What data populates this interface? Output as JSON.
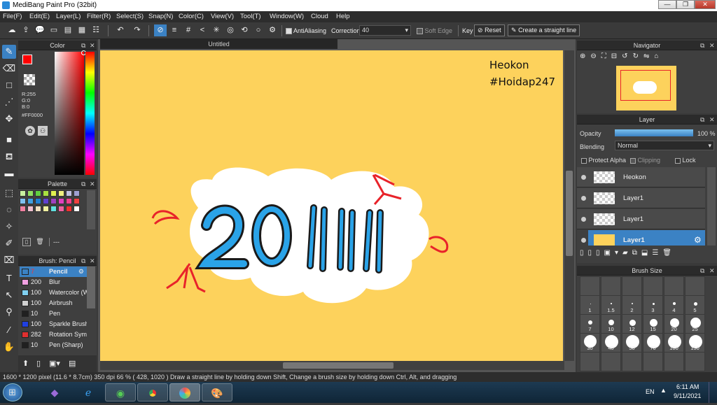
{
  "window": {
    "title": "MediBang Paint Pro (32bit)"
  },
  "menu": [
    "File(F)",
    "Edit(E)",
    "Layer(L)",
    "Filter(R)",
    "Select(S)",
    "Snap(N)",
    "Color(C)",
    "View(V)",
    "Tool(T)",
    "Window(W)",
    "Cloud",
    "Help"
  ],
  "toolbar": {
    "antialiasing": "AntiAliasing",
    "correction_label": "Correction",
    "correction_value": "40",
    "soft_edge": "Soft Edge",
    "key_label": "Key",
    "reset": "Reset",
    "straight_line": "Create a straight line"
  },
  "color_panel": {
    "title": "Color",
    "r": "R:255",
    "g": "G:0",
    "b": "B:0",
    "hex": "#FF0000",
    "primary": "#ff0000"
  },
  "palette_panel": {
    "title": "Palette",
    "extra": "---",
    "swatches": [
      "#c8f0a0",
      "#90e060",
      "#60d040",
      "#a8e040",
      "#e0f050",
      "#f0f080",
      "#c0c0e0",
      "#a0a0d0",
      "#80c0f0",
      "#40a0e0",
      "#2080d0",
      "#6040d0",
      "#a040c0",
      "#e040c0",
      "#f04090",
      "#f04040",
      "#f080a0",
      "#f0c0d0",
      "#f0e0c0",
      "#f0f0a0",
      "#60e0e0",
      "#f060a0",
      "#f03030",
      "#ffffff"
    ]
  },
  "brush_panel": {
    "title": "Brush: Pencil",
    "items": [
      {
        "size": "7",
        "name": "Pencil",
        "color": "#3b82c4"
      },
      {
        "size": "200",
        "name": "Blur",
        "color": "#f0a0e0"
      },
      {
        "size": "100",
        "name": "Watercolor (W",
        "color": "#80d0f0"
      },
      {
        "size": "100",
        "name": "Airbrush",
        "color": "#d0d0d0"
      },
      {
        "size": "10",
        "name": "Pen",
        "color": "#202020"
      },
      {
        "size": "100",
        "name": "Sparkle Brush",
        "color": "#2040e0"
      },
      {
        "size": "282",
        "name": "Rotation Sym",
        "color": "#e03030"
      },
      {
        "size": "10",
        "name": "Pen (Sharp)",
        "color": "#202020"
      }
    ]
  },
  "document": {
    "tab": "Untitled",
    "text_line1": "Heokon",
    "text_line2": "#Hoidap247",
    "art_text": "2011"
  },
  "navigator": {
    "title": "Navigator"
  },
  "layer_panel": {
    "title": "Layer",
    "opacity_label": "Opacity",
    "opacity_value": "100 %",
    "opacity_level": 1.0,
    "blending_label": "Blending",
    "blending_value": "Normal",
    "protect_alpha": "Protect Alpha",
    "clipping": "Clipping",
    "lock": "Lock",
    "layers": [
      "Heokon",
      "Layer1",
      "Layer1",
      "Layer1"
    ]
  },
  "brush_size_panel": {
    "title": "Brush Size",
    "sizes": [
      "1",
      "1.5",
      "2",
      "3",
      "4",
      "5",
      "7",
      "10",
      "12",
      "15",
      "20",
      "25",
      "30",
      "40",
      "50",
      "70",
      "100",
      "150"
    ]
  },
  "status": {
    "text": "1600 * 1200 pixel   (11.6 * 8.7cm)   350 dpi   66 %   ( 428, 1020 )   Draw a straight line by holding down Shift, Change a brush size by holding down Ctrl, Alt, and dragging"
  },
  "taskbar": {
    "lang": "EN",
    "time": "6:11 AM",
    "date": "9/11/2021"
  }
}
